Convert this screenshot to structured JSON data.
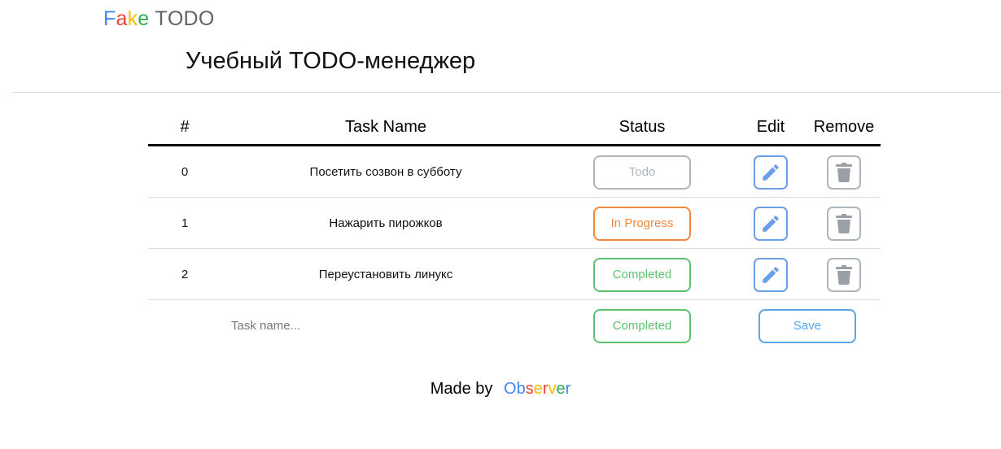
{
  "logo": {
    "letters": [
      {
        "char": "F",
        "color": "#4285f4"
      },
      {
        "char": "a",
        "color": "#ea4335"
      },
      {
        "char": "k",
        "color": "#fbbc05"
      },
      {
        "char": "e",
        "color": "#34a853"
      },
      {
        "char": " ",
        "color": "#5f6368"
      },
      {
        "char": "T",
        "color": "#5f6368"
      },
      {
        "char": "O",
        "color": "#5f6368"
      },
      {
        "char": "D",
        "color": "#5f6368"
      },
      {
        "char": "O",
        "color": "#5f6368"
      }
    ]
  },
  "page": {
    "title": "Учебный TODO-менеджер"
  },
  "table": {
    "headers": {
      "index": "#",
      "name": "Task Name",
      "status": "Status",
      "edit": "Edit",
      "remove": "Remove"
    },
    "rows": [
      {
        "index": "0",
        "name": "Посетить созвон в субботу",
        "status": "Todo",
        "status_type": "todo"
      },
      {
        "index": "1",
        "name": "Нажарить пирожков",
        "status": "In Progress",
        "status_type": "progress"
      },
      {
        "index": "2",
        "name": "Переустановить линукс",
        "status": "Completed",
        "status_type": "completed"
      }
    ],
    "icons": {
      "edit": "pencil-icon",
      "remove": "trash-icon"
    }
  },
  "new_task": {
    "placeholder": "Task name...",
    "value": "",
    "status": "Completed",
    "save_label": "Save"
  },
  "footer": {
    "made_by": "Made by",
    "author_letters": [
      {
        "char": "O",
        "color": "#4285f4"
      },
      {
        "char": "b",
        "color": "#4285f4"
      },
      {
        "char": "s",
        "color": "#ea4335"
      },
      {
        "char": "e",
        "color": "#fbbc05"
      },
      {
        "char": "r",
        "color": "#ea4335"
      },
      {
        "char": "v",
        "color": "#fbbc05"
      },
      {
        "char": "e",
        "color": "#34a853"
      },
      {
        "char": "r",
        "color": "#4285f4"
      }
    ]
  },
  "colors": {
    "todo": "#adb5bd",
    "progress": "#f0883e",
    "completed": "#5cc26e",
    "edit": "#6b9ee8",
    "save": "#5aa6e8"
  }
}
